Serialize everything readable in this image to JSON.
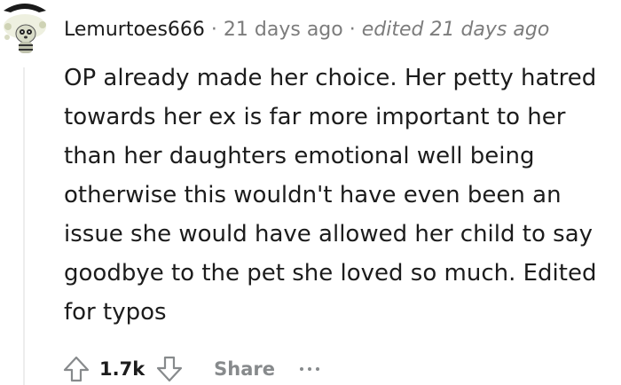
{
  "comment": {
    "username": "Lemurtoes666",
    "separator": "·",
    "time": "21 days ago",
    "edited": "edited 21 days ago",
    "body": "OP already made her choice. Her petty hatred towards her ex is far more important to her than her daughters emotional well being otherwise this wouldn't have even been an issue she would have allowed her child to say goodbye to the pet she loved so much. Edited for typos",
    "avatar_icon": "lemur-avatar-icon"
  },
  "actions": {
    "upvote_icon": "arrow-up-icon",
    "score": "1.7k",
    "downvote_icon": "arrow-down-icon",
    "share_label": "Share",
    "more_icon": "ellipsis-icon"
  },
  "colors": {
    "text": "#1c1c1c",
    "meta": "#7c7c7c",
    "action_gray": "#878a8c",
    "thread_line": "#ededed"
  }
}
